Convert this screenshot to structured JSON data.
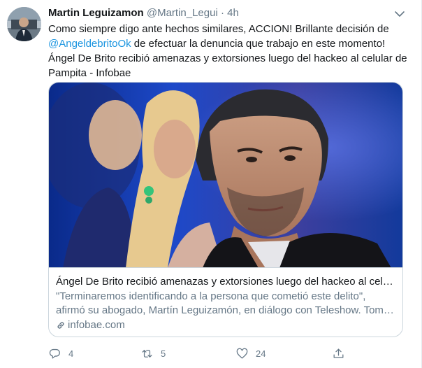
{
  "tweet": {
    "author_name": "Martin Leguizamon",
    "handle": "@Martin_Legui",
    "separator": "·",
    "timestamp": "4h",
    "text_lines": [
      "Como siempre digo ante hechos similares, ACCION! Brillante decisión de",
      "de efectuar la denuncia que trabajo en este momento!",
      "Ángel De Brito recibió amenazas y extorsiones luego del hackeo al celular de",
      "Pampita - Infobae"
    ],
    "mention": "@AngeldebritoOk",
    "menu_icon": "chevron-down-icon"
  },
  "card": {
    "title": "Ángel De Brito recibió amenazas y extorsiones luego del hackeo al celular de Pampita",
    "description_lines": [
      "\"Terminaremos identificando a la persona que cometió este delito\",",
      "afirmó su abogado, Martín Leguizamón, en diálogo con Teleshow. Tomó nota de todo"
    ],
    "domain": "infobae.com",
    "domain_icon": "link-icon"
  },
  "actions": {
    "reply_count": "4",
    "retweet_count": "5",
    "like_count": "24",
    "reply_icon": "reply-icon",
    "retweet_icon": "retweet-icon",
    "like_icon": "heart-icon",
    "share_icon": "share-icon"
  },
  "colors": {
    "link": "#1b95e0",
    "secondary_text": "#657786",
    "border": "#ccd6dd"
  }
}
